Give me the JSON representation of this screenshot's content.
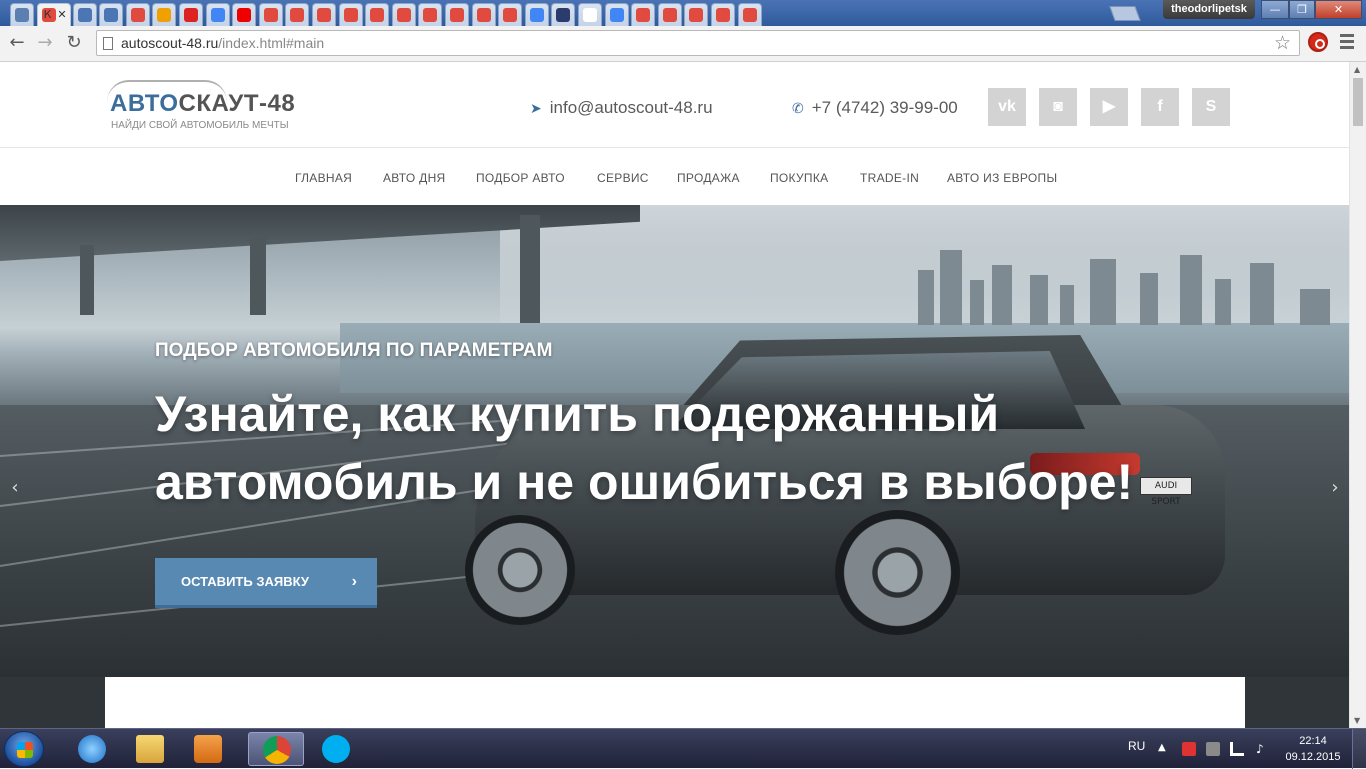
{
  "browser": {
    "user_badge": "theodorlipetsk",
    "active_tab_letter": "К",
    "url_main": "autoscout-48.ru",
    "url_rest": "/index.html#main",
    "window_min": "—",
    "window_max": "❐",
    "window_close": "✕",
    "tab_favicons": [
      "#5b7fb0",
      "#e04a3f",
      "#4b75b3",
      "#4b75b3",
      "#e04a3f",
      "#f0a000",
      "#d22",
      "#4285f4",
      "#e00",
      "#e04a3f",
      "#e04a3f",
      "#e04a3f",
      "#e04a3f",
      "#e04a3f",
      "#e04a3f",
      "#e04a3f",
      "#e04a3f",
      "#e04a3f",
      "#e04a3f",
      "#4285f4",
      "#2b3b6b",
      "#fff",
      "#4285f4",
      "#e04a3f",
      "#e04a3f",
      "#e04a3f",
      "#e04a3f",
      "#e04a3f"
    ]
  },
  "site": {
    "logo_part1": "АВТО",
    "logo_part2": "СКАУТ-48",
    "logo_tagline": "НАЙДИ СВОЙ АВТОМОБИЛЬ МЕЧТЫ",
    "email": "info@autoscout-48.ru",
    "phone": "+7 (4742) 39-99-00",
    "social": [
      {
        "name": "vk-icon",
        "glyph": "vk"
      },
      {
        "name": "instagram-icon",
        "glyph": "◙"
      },
      {
        "name": "youtube-icon",
        "glyph": "▶"
      },
      {
        "name": "facebook-icon",
        "glyph": "f"
      },
      {
        "name": "skype-icon",
        "glyph": "S"
      }
    ],
    "nav": [
      "ГЛАВНАЯ",
      "АВТО ДНЯ",
      "ПОДБОР АВТО",
      "СЕРВИС",
      "ПРОДАЖА",
      "ПОКУПКА",
      "TRADE-IN",
      "АВТО ИЗ ЕВРОПЫ"
    ]
  },
  "hero": {
    "subtitle": "ПОДБОР АВТОМОБИЛЯ ПО ПАРАМЕТРАМ",
    "title": "Узнайте, как купить подержанный автомобиль и не ошибиться в выборе!",
    "cta": "ОСТАВИТЬ ЗАЯВКУ",
    "plate": "AUDI SPORT",
    "arrow_prev": "‹",
    "arrow_next": "›"
  },
  "taskbar": {
    "lang": "RU",
    "time": "22:14",
    "date": "09.12.2015"
  },
  "colors": {
    "brand_blue": "#3c6e9d",
    "cta_blue": "#5889b3"
  }
}
